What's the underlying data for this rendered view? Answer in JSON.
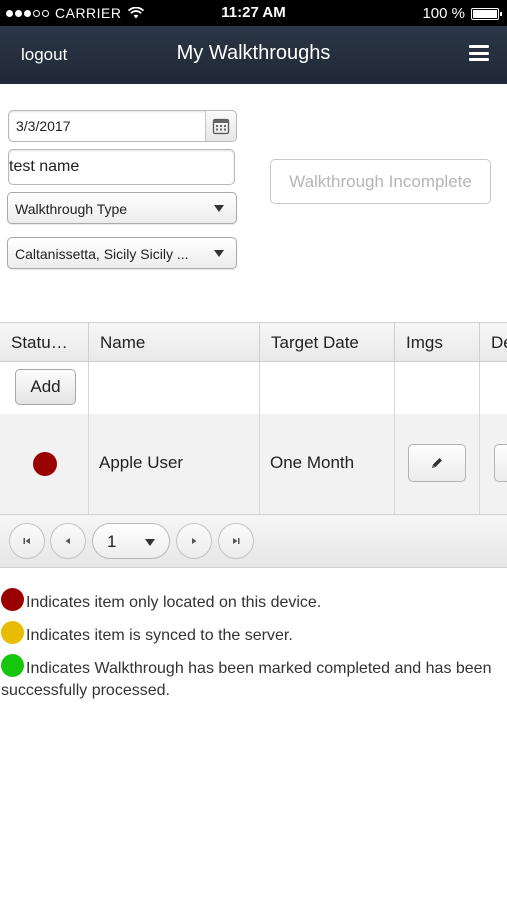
{
  "status_bar": {
    "carrier": "CARRIER",
    "time": "11:27 AM",
    "battery": "100 %"
  },
  "nav": {
    "logout": "logout",
    "title": "My Walkthroughs",
    "menu_icon": "hamburger-menu-icon"
  },
  "form": {
    "date": "3/3/2017",
    "name_value": "test name",
    "walkthrough_type": "Walkthrough Type",
    "location": "Caltanissetta, Sicily Sicily ...",
    "incomplete_button": "Walkthrough Incomplete"
  },
  "grid": {
    "columns": [
      "Statu…",
      "Name",
      "Target Date",
      "Imgs",
      "De"
    ],
    "add_label": "Add",
    "rows": [
      {
        "status_color": "#9a0000",
        "name": "Apple User",
        "target_date": "One Month"
      }
    ],
    "page": "1"
  },
  "legend": [
    {
      "color": "#9a0000",
      "text": "Indicates item only located on this device."
    },
    {
      "color": "#e8bd00",
      "text": "Indicates item is synced to the server."
    },
    {
      "color": "#16c60c",
      "text": "Indicates Walkthrough has been marked completed and has been successfully processed."
    }
  ],
  "colors": {
    "nav_bg": "#263142",
    "status_red": "#9a0000",
    "status_yellow": "#e8bd00",
    "status_green": "#16c60c"
  }
}
